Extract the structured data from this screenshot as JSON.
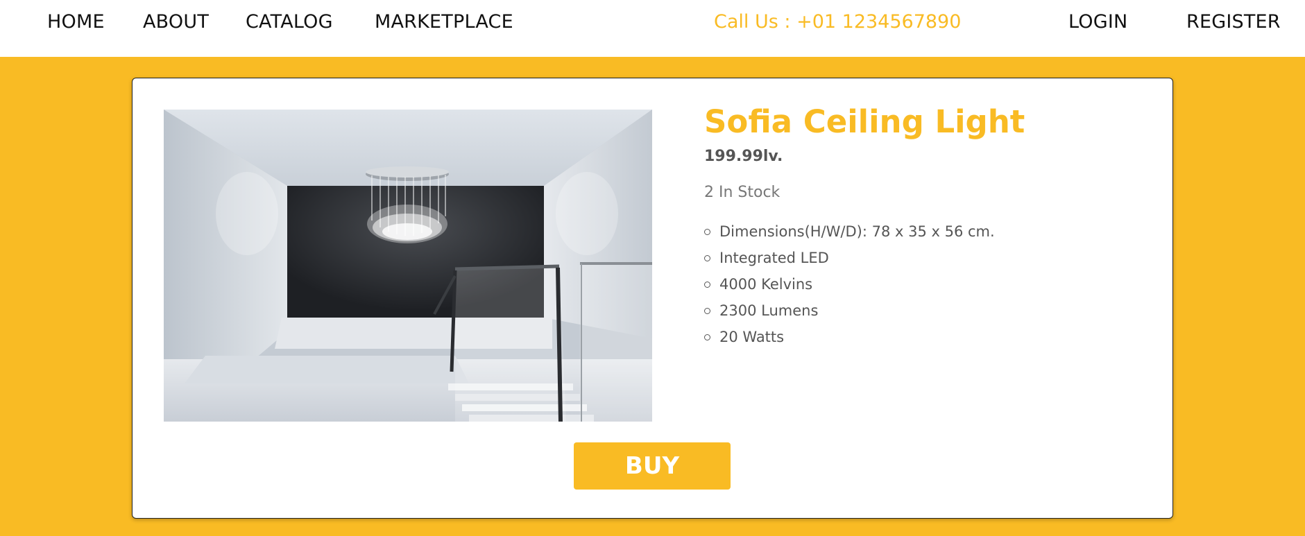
{
  "nav": {
    "home": "HOME",
    "about": "ABOUT",
    "catalog": "CATALOG",
    "marketplace": "MARKETPLACE",
    "phone": "Call Us : +01 1234567890",
    "login": "LOGIN",
    "register": "REGISTER"
  },
  "product": {
    "title": "Sofia Ceiling Light",
    "price": "199.99lv.",
    "stock": "2 In Stock",
    "specs": [
      "Dimensions(H/W/D): 78 x 35 x 56 cm.",
      "Integrated LED",
      "4000 Kelvins",
      "2300 Lumens",
      "20 Watts"
    ],
    "buy_label": "BUY",
    "image_icon": "chandelier-photo"
  },
  "colors": {
    "accent": "#f9bb24",
    "text_dark": "#111111",
    "text_muted": "#555555"
  }
}
